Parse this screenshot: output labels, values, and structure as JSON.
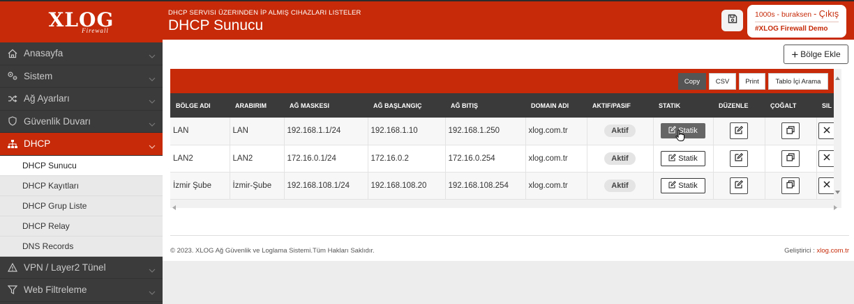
{
  "brand": {
    "logo": "XLOG",
    "logo_sub": "Firewall",
    "accent": "#c62a08",
    "dark": "#3a3a3a"
  },
  "header": {
    "subtitle": "DHCP SERVISI ÜZERINDEN İP ALMIŞ CIHAZLARI LISTELER",
    "title": "DHCP Sunucu",
    "save_icon": "floppy-disk-icon",
    "user": "1000s - buraksen",
    "logout": "- Çıkış",
    "company": "#XLOG Firewall Demo"
  },
  "sidebar": {
    "items": [
      {
        "label": "Anasayfa",
        "icon": "home-icon"
      },
      {
        "label": "Sistem",
        "icon": "gears-icon"
      },
      {
        "label": "Ağ Ayarları",
        "icon": "shuffle-icon"
      },
      {
        "label": "Güvenlik Duvarı",
        "icon": "shield-icon"
      },
      {
        "label": "DHCP",
        "icon": "sitemap-icon"
      }
    ],
    "dhcp_sub": [
      {
        "label": "DHCP Sunucu"
      },
      {
        "label": "DHCP Kayıtları"
      },
      {
        "label": "DHCP Grup Liste"
      },
      {
        "label": "DHCP Relay"
      },
      {
        "label": "DNS Records"
      }
    ],
    "bottom_items": [
      {
        "label": "VPN / Layer2 Tünel",
        "icon": "warning-icon"
      },
      {
        "label": "Web Filtreleme",
        "icon": "filter-icon"
      }
    ]
  },
  "toolbar": {
    "add_region": "Bölge Ekle",
    "copy": "Copy",
    "csv": "CSV",
    "print": "Print",
    "search": "Tablo İçi Arama"
  },
  "table": {
    "headers": [
      "BÖLGE ADI",
      "ARABIRIM",
      "AĞ MASKESI",
      "AĞ BAŞLANGIÇ",
      "AĞ BITIŞ",
      "DOMAIN ADI",
      "AKTIF/PASIF",
      "STATIK",
      "DÜZENLE",
      "ÇOĞALT",
      "SIL"
    ],
    "rows": [
      {
        "region": "LAN",
        "iface": "LAN",
        "mask": "192.168.1.1/24",
        "start": "192.168.1.10",
        "end": "192.168.1.250",
        "domain": "xlog.com.tr",
        "status": "Aktif",
        "statik": "Statik"
      },
      {
        "region": "LAN2",
        "iface": "LAN2",
        "mask": "172.16.0.1/24",
        "start": "172.16.0.2",
        "end": "172.16.0.254",
        "domain": "xlog.com.tr",
        "status": "Aktif",
        "statik": "Statik"
      },
      {
        "region": "İzmir Şube",
        "iface": "İzmir-Şube",
        "mask": "192.168.108.1/24",
        "start": "192.168.108.20",
        "end": "192.168.108.254",
        "domain": "xlog.com.tr",
        "status": "Aktif",
        "statik": "Statik"
      }
    ]
  },
  "footer": {
    "copyright": "© 2023. XLOG Ağ Güvenlik ve Loglama Sistemi.Tüm Hakları Saklıdır.",
    "dev_label": "Geliştirici :",
    "dev_link": "xlog.com.tr"
  }
}
